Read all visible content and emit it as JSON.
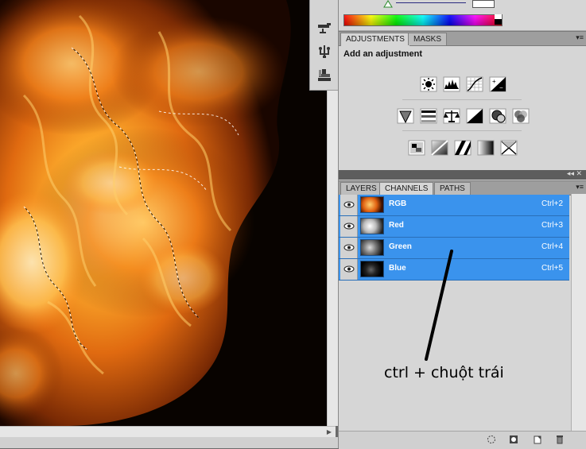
{
  "colors": {
    "selection": "#3a93ed",
    "panel": "#d6d6d6",
    "fire_dark": "#060200",
    "fire_orange": "#f08020"
  },
  "tools": [
    {
      "icon": "brush-tool-icon"
    },
    {
      "icon": "clone-stamp-icon"
    },
    {
      "icon": "stamp-tool-icon"
    }
  ],
  "adjustments_panel": {
    "tabs": [
      "ADJUSTMENTS",
      "MASKS"
    ],
    "title": "Add an adjustment",
    "rows": [
      [
        "brightness-contrast-icon",
        "levels-icon",
        "curves-icon",
        "exposure-icon"
      ],
      [
        "vibrance-icon",
        "hue-saturation-icon",
        "color-balance-icon",
        "black-white-icon",
        "photo-filter-icon",
        "channel-mixer-icon"
      ],
      [
        "invert-icon",
        "posterize-icon",
        "threshold-icon",
        "gradient-map-icon",
        "selective-color-icon"
      ]
    ]
  },
  "layers_panel": {
    "tabs": [
      "LAYERS",
      "CHANNELS",
      "PATHS"
    ],
    "active_tab": "CHANNELS",
    "channels": [
      {
        "name": "RGB",
        "shortcut": "Ctrl+2"
      },
      {
        "name": "Red",
        "shortcut": "Ctrl+3"
      },
      {
        "name": "Green",
        "shortcut": "Ctrl+4"
      },
      {
        "name": "Blue",
        "shortcut": "Ctrl+5"
      }
    ],
    "annotation": "ctrl + chuột trái",
    "bottom_icons": [
      "load-selection-icon",
      "save-selection-icon",
      "new-channel-icon",
      "delete-channel-icon"
    ]
  }
}
